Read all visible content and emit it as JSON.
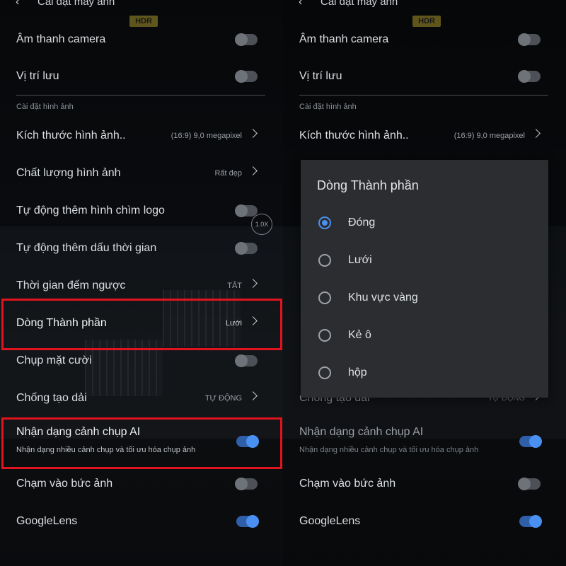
{
  "header": {
    "title": "Cài đặt máy ảnh",
    "hdr_badge": "HDR"
  },
  "zoom_badge": "1.0X",
  "settings": {
    "camera_sound": "Âm thanh camera",
    "storage_location": "Vị trí lưu",
    "image_settings_section": "Cài đặt hình ảnh",
    "image_size": {
      "label": "Kích thước hình ảnh..",
      "value": "(16:9) 9,0 megapixel"
    },
    "image_quality": {
      "label": "Chất lượng hình ảnh",
      "value": "Rất đẹp"
    },
    "auto_watermark": "Tự động thêm hình chìm logo",
    "auto_timestamp": "Tự động thêm dấu thời gian",
    "countdown": {
      "label": "Thời gian đếm ngược",
      "value": "TẮT"
    },
    "composition_line": {
      "label": "Dòng Thành phần",
      "value": "Lưới"
    },
    "smile_capture": "Chụp mặt cười",
    "anti_banding": {
      "label": "Chống tạo dải",
      "value": "TỰ ĐỘNG"
    },
    "ai_scene": {
      "label": "Nhận dạng cảnh chụp AI",
      "sub": "Nhận dạng nhiều cảnh chụp và tối ưu hóa chụp ảnh"
    },
    "touch_capture": "Chạm vào bức ảnh",
    "google_lens": "GoogleLens"
  },
  "toggles": {
    "camera_sound": false,
    "storage_location": false,
    "auto_watermark": false,
    "auto_timestamp": false,
    "smile_capture": false,
    "ai_scene": true,
    "touch_capture": false,
    "google_lens": true
  },
  "dialog": {
    "title": "Dòng Thành phần",
    "options": [
      {
        "label": "Đóng",
        "selected": true
      },
      {
        "label": "Lưới",
        "selected": false
      },
      {
        "label": "Khu vực vàng",
        "selected": false
      },
      {
        "label": "Kẻ ô",
        "selected": false
      },
      {
        "label": "hộp",
        "selected": false
      }
    ]
  },
  "colors": {
    "accent": "#4a90f0",
    "highlight": "#e0141e"
  }
}
